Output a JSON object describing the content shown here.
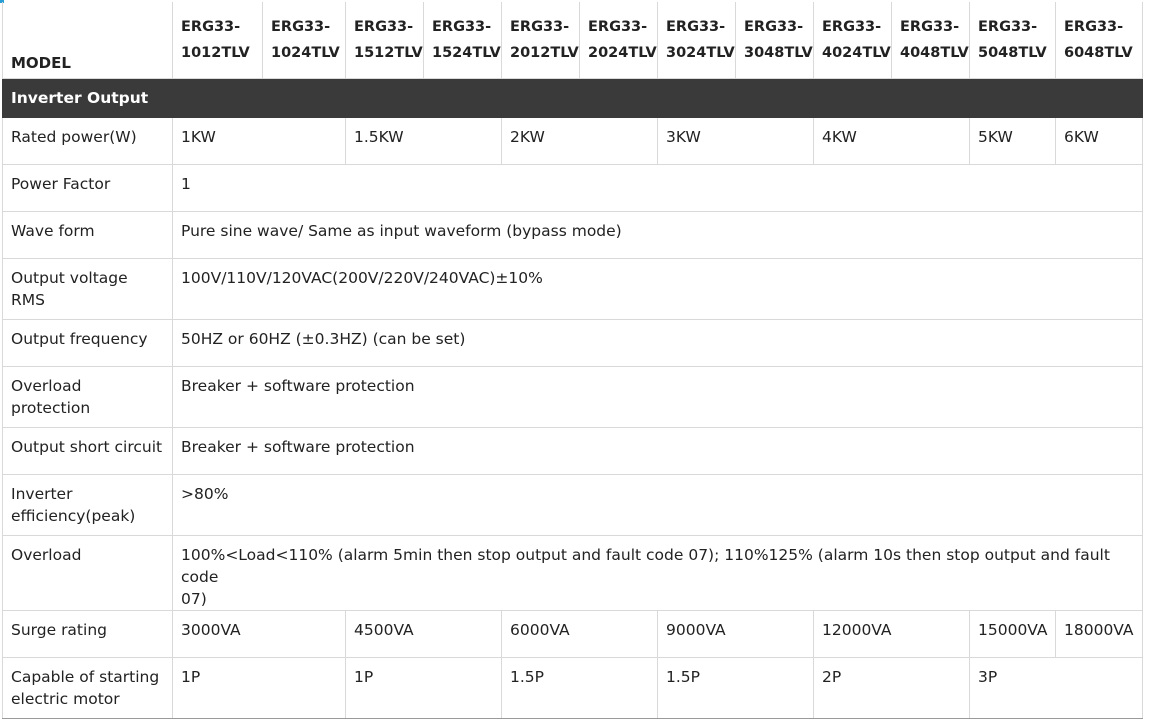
{
  "header": {
    "model_label": "MODEL",
    "models": [
      [
        "ERG33-",
        "1012TLV"
      ],
      [
        "ERG33-",
        "1024TLV"
      ],
      [
        "ERG33-",
        "1512TLV"
      ],
      [
        "ERG33-",
        "1524TLV"
      ],
      [
        "ERG33-",
        "2012TLV"
      ],
      [
        "ERG33-",
        "2024TLV"
      ],
      [
        "ERG33-",
        "3024TLV"
      ],
      [
        "ERG33-",
        "3048TLV"
      ],
      [
        "ERG33-",
        "4024TLV"
      ],
      [
        "ERG33-",
        "4048TLV"
      ],
      [
        "ERG33-",
        "5048TLV"
      ],
      [
        "ERG33-",
        "6048TLV"
      ]
    ]
  },
  "section_title": "Inverter Output",
  "rows": {
    "rated_power": {
      "label": "Rated power(W)",
      "values": [
        "1KW",
        "1.5KW",
        "2KW",
        "3KW",
        "4KW",
        "5KW",
        "6KW"
      ]
    },
    "power_factor": {
      "label": "Power Factor",
      "value": "1"
    },
    "wave_form": {
      "label": "Wave form",
      "value": "Pure sine wave/ Same as input waveform (bypass mode)"
    },
    "output_voltage": {
      "label_1": "Output voltage",
      "label_2": "RMS",
      "value": "100V/110V/120VAC(200V/220V/240VAC)±10%"
    },
    "output_frequency": {
      "label": "Output frequency",
      "value": "50HZ or 60HZ (±0.3HZ) (can be set)"
    },
    "overload_protection": {
      "label_1": "Overload",
      "label_2": "protection",
      "value": "Breaker + software protection"
    },
    "output_short_circuit": {
      "label": "Output short circuit",
      "value": "Breaker + software protection"
    },
    "inverter_efficiency": {
      "label_1": "Inverter",
      "label_2": "efficiency(peak)",
      "value": ">80%"
    },
    "overload": {
      "label": "Overload",
      "value_1": "100%<Load<110% (alarm 5min then stop output and fault code 07); 110%125% (alarm 10s then stop output and fault code",
      "value_2": "07)"
    },
    "surge_rating": {
      "label": "Surge rating",
      "values": [
        "3000VA",
        "4500VA",
        "6000VA",
        "9000VA",
        "12000VA",
        "15000VA",
        "18000VA"
      ]
    },
    "starting_motor": {
      "label_1": "Capable of starting",
      "label_2": "electric motor",
      "values": [
        "1P",
        "1P",
        "1.5P",
        "1.5P",
        "2P",
        "3P"
      ]
    }
  },
  "colors": {
    "section_bg": "#3a3a3a",
    "section_text": "#ffffff",
    "border": "#d9d9d9",
    "text": "#222222"
  }
}
